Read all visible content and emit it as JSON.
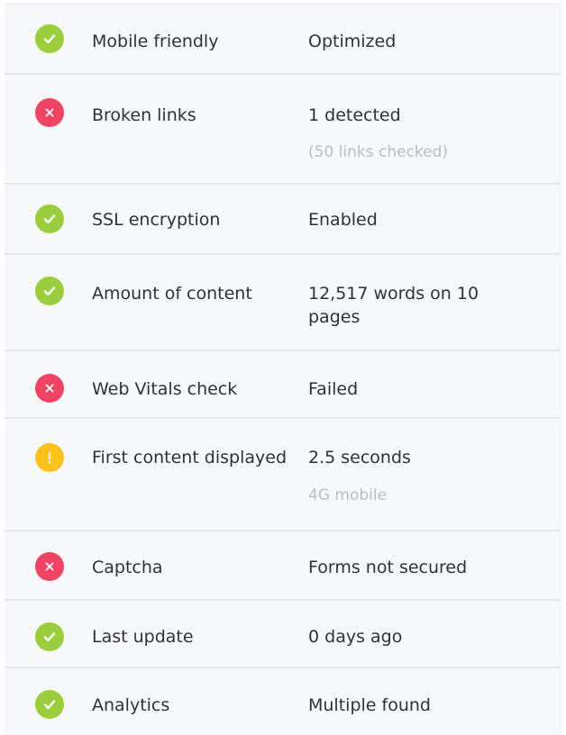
{
  "colors": {
    "pass": "#9ccd3c",
    "fail": "#ef4463",
    "warn": "#fdc11d"
  },
  "checks": [
    {
      "status": "pass",
      "icon": "check-icon",
      "label": "Mobile friendly",
      "value": "Optimized",
      "note": ""
    },
    {
      "status": "fail",
      "icon": "cross-icon",
      "label": "Broken links",
      "value": "1 detected",
      "note": "(50 links checked)"
    },
    {
      "status": "pass",
      "icon": "check-icon",
      "label": "SSL encryption",
      "value": "Enabled",
      "note": ""
    },
    {
      "status": "pass",
      "icon": "check-icon",
      "label": "Amount of content",
      "value": "12,517 words on 10 pages",
      "note": ""
    },
    {
      "status": "fail",
      "icon": "cross-icon",
      "label": "Web Vitals check",
      "value": "Failed",
      "note": ""
    },
    {
      "status": "warn",
      "icon": "exclamation-icon",
      "label": "First content displayed",
      "value": "2.5 seconds",
      "note": "4G mobile"
    },
    {
      "status": "fail",
      "icon": "cross-icon",
      "label": "Captcha",
      "value": "Forms not secured",
      "note": ""
    },
    {
      "status": "pass",
      "icon": "check-icon",
      "label": "Last update",
      "value": "0 days ago",
      "note": ""
    },
    {
      "status": "pass",
      "icon": "check-icon",
      "label": "Analytics",
      "value": "Multiple found",
      "note": ""
    }
  ]
}
